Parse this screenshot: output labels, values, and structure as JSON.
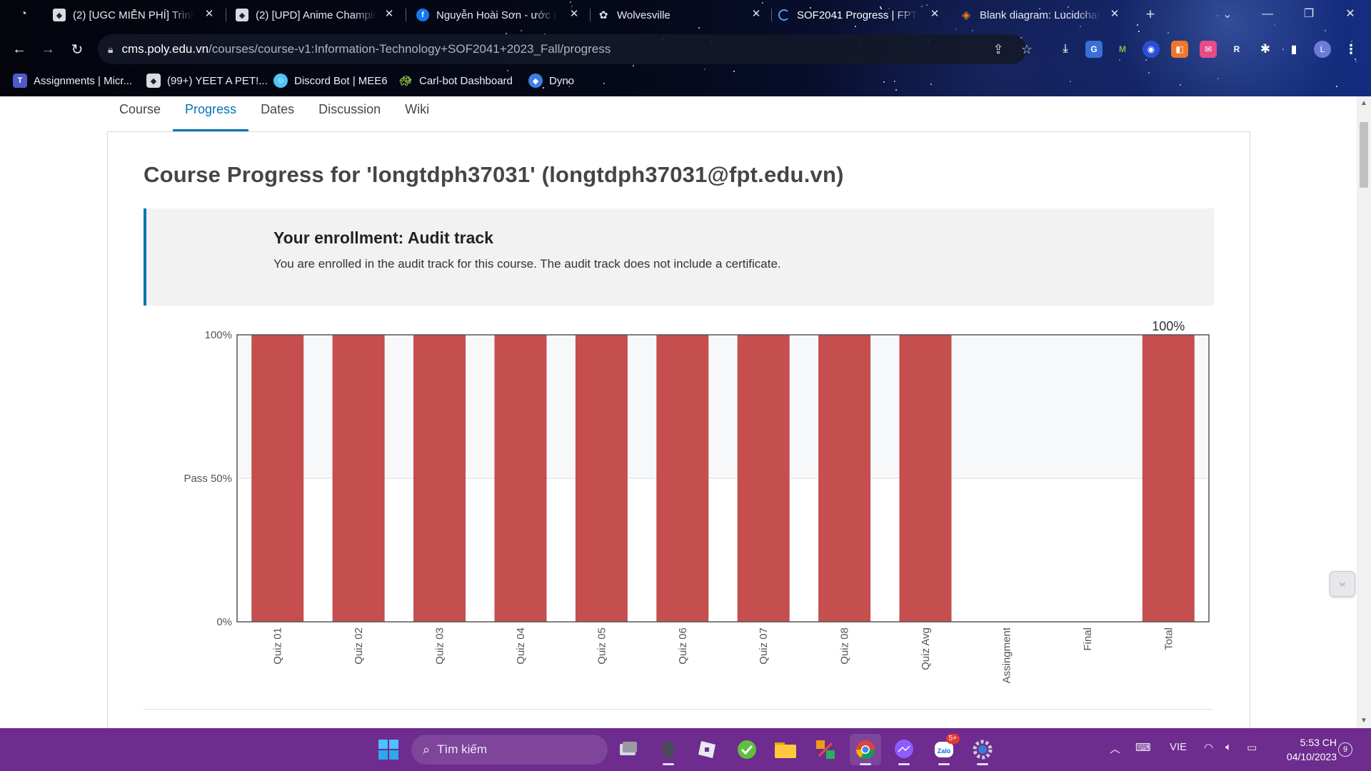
{
  "browser": {
    "tabs": [
      {
        "title": "(2) [UGC MIỄN PHÍ] Trình",
        "icon": "roblox-icon",
        "active": false
      },
      {
        "title": "(2) [UPD] Anime Champio",
        "icon": "roblox-icon",
        "active": false
      },
      {
        "title": "Nguyễn Hoài Sơn - ước g",
        "icon": "facebook-icon",
        "active": false
      },
      {
        "title": "Wolvesville",
        "icon": "wolvesville-icon",
        "active": false
      },
      {
        "title": "SOF2041 Progress | FPT P",
        "icon": "loading-icon",
        "active": true
      },
      {
        "title": "Blank diagram: Lucidchar",
        "icon": "lucidchart-icon",
        "active": false
      }
    ],
    "url_host": "cms.poly.edu.vn",
    "url_path": "/courses/course-v1:Information-Technology+SOF2041+2023_Fall/progress",
    "profile_initial": "L",
    "bookmarks": [
      {
        "label": "Assignments | Micr...",
        "icon": "teams-icon"
      },
      {
        "label": "(99+) YEET A PET!...",
        "icon": "roblox-icon"
      },
      {
        "label": "Discord Bot | MEE6",
        "icon": "mee6-icon"
      },
      {
        "label": "Carl-bot Dashboard",
        "icon": "carlbot-icon"
      },
      {
        "label": "Dyno",
        "icon": "dyno-icon"
      }
    ]
  },
  "course_nav": {
    "items": [
      "Course",
      "Progress",
      "Dates",
      "Discussion",
      "Wiki"
    ],
    "active": "Progress"
  },
  "progress": {
    "title": "Course Progress for 'longtdph37031' (longtdph37031@fpt.edu.vn)",
    "enrollment_title": "Your enrollment: Audit track",
    "enrollment_text": "You are enrolled in the audit track for this course. The audit track does not include a certificate."
  },
  "chart_data": {
    "type": "bar",
    "title": "",
    "categories": [
      "Quiz 01",
      "Quiz 02",
      "Quiz 03",
      "Quiz 04",
      "Quiz 05",
      "Quiz 06",
      "Quiz 07",
      "Quiz 08",
      "Quiz Avg",
      "Assingment",
      "Final",
      "Total"
    ],
    "values": [
      100,
      100,
      100,
      100,
      100,
      100,
      100,
      100,
      100,
      0,
      0,
      100
    ],
    "ylim": [
      0,
      100
    ],
    "y_ticks": [
      {
        "value": 0,
        "label": "0%"
      },
      {
        "value": 50,
        "label": "Pass 50%"
      },
      {
        "value": 100,
        "label": "100%"
      }
    ],
    "total_label": "100%",
    "pass_threshold": 50,
    "bar_color": "#c54e4e",
    "pass_band_color": "#f7f8fa"
  },
  "taskbar": {
    "search_placeholder": "Tìm kiếm",
    "language": "VIE",
    "time": "5:53 CH",
    "date": "04/10/2023",
    "notification_count": "9",
    "zalo_badge": "5+"
  },
  "colors": {
    "accent": "#0075b4",
    "taskbar": "#6d2c8e"
  }
}
